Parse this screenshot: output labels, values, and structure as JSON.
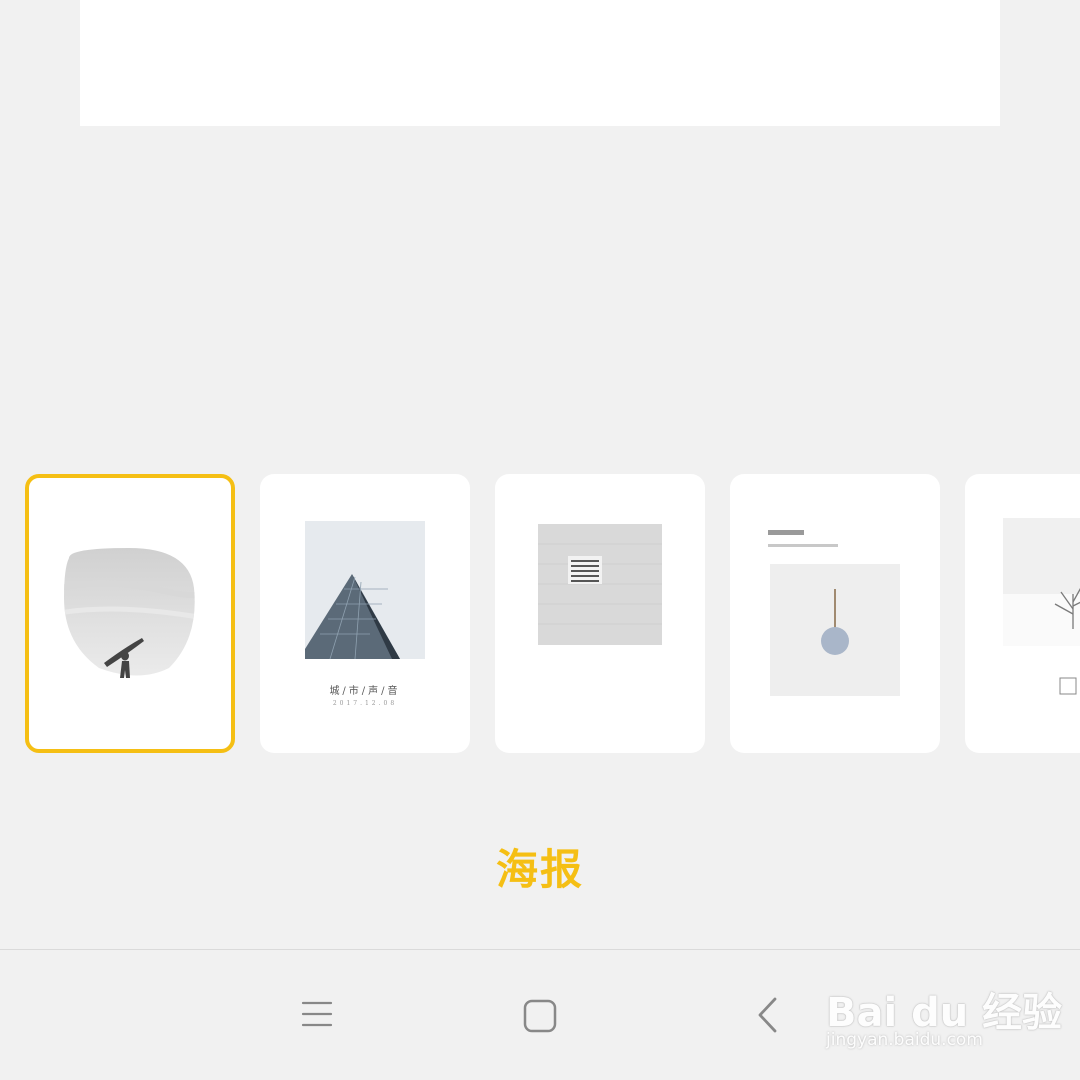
{
  "templates": [
    {
      "id": "surfer",
      "selected": true,
      "caption": "",
      "subcaption": ""
    },
    {
      "id": "building",
      "selected": false,
      "caption": "城/市/声/音",
      "subcaption": "2017.12.08"
    },
    {
      "id": "vent-wall",
      "selected": false,
      "caption": "",
      "subcaption": ""
    },
    {
      "id": "wall-clock",
      "selected": false,
      "caption": "",
      "subcaption": ""
    },
    {
      "id": "snow-tree",
      "selected": false,
      "caption": "",
      "subcaption": ""
    }
  ],
  "category": {
    "label": "海报",
    "color": "#f5bf14"
  },
  "nav": {
    "menu_icon": "menu-icon",
    "home_icon": "home-icon",
    "back_icon": "back-icon"
  },
  "watermark": {
    "logo_text": "Bai du 经验",
    "url": "jingyan.baidu.com"
  },
  "colors": {
    "accent": "#f5bf14",
    "background": "#f1f1f1",
    "card": "#ffffff"
  }
}
